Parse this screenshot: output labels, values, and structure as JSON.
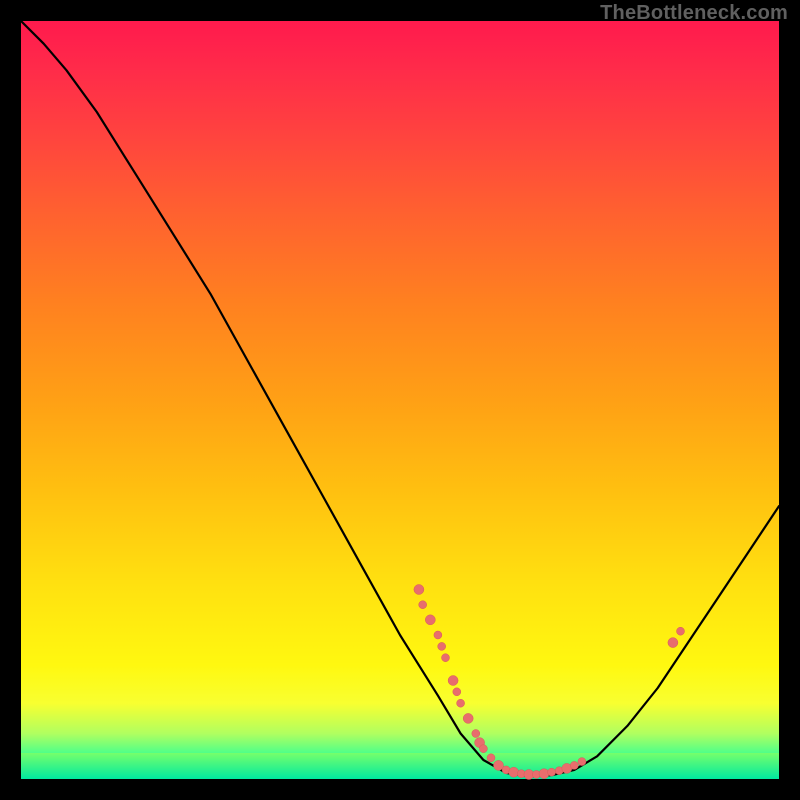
{
  "watermark": "TheBottleneck.com",
  "colors": {
    "curve_stroke": "#000000",
    "point_fill": "#e86d6d",
    "point_stroke": "#d85a5a"
  },
  "chart_data": {
    "type": "line",
    "title": "",
    "xlabel": "",
    "ylabel": "",
    "xlim": [
      0,
      100
    ],
    "ylim": [
      0,
      100
    ],
    "curve": [
      {
        "x": 0,
        "y": 100
      },
      {
        "x": 3,
        "y": 97
      },
      {
        "x": 6,
        "y": 93.5
      },
      {
        "x": 10,
        "y": 88
      },
      {
        "x": 15,
        "y": 80
      },
      {
        "x": 20,
        "y": 72
      },
      {
        "x": 25,
        "y": 64
      },
      {
        "x": 30,
        "y": 55
      },
      {
        "x": 35,
        "y": 46
      },
      {
        "x": 40,
        "y": 37
      },
      {
        "x": 45,
        "y": 28
      },
      {
        "x": 50,
        "y": 19
      },
      {
        "x": 55,
        "y": 11
      },
      {
        "x": 58,
        "y": 6
      },
      {
        "x": 61,
        "y": 2.5
      },
      {
        "x": 64,
        "y": 0.8
      },
      {
        "x": 67,
        "y": 0.3
      },
      {
        "x": 70,
        "y": 0.5
      },
      {
        "x": 73,
        "y": 1.2
      },
      {
        "x": 76,
        "y": 3
      },
      {
        "x": 80,
        "y": 7
      },
      {
        "x": 84,
        "y": 12
      },
      {
        "x": 88,
        "y": 18
      },
      {
        "x": 92,
        "y": 24
      },
      {
        "x": 96,
        "y": 30
      },
      {
        "x": 100,
        "y": 36
      }
    ],
    "points": [
      {
        "x": 52.5,
        "y": 25,
        "r": 5
      },
      {
        "x": 53,
        "y": 23,
        "r": 4
      },
      {
        "x": 54,
        "y": 21,
        "r": 5
      },
      {
        "x": 55,
        "y": 19,
        "r": 4
      },
      {
        "x": 55.5,
        "y": 17.5,
        "r": 4
      },
      {
        "x": 56,
        "y": 16,
        "r": 4
      },
      {
        "x": 57,
        "y": 13,
        "r": 5
      },
      {
        "x": 57.5,
        "y": 11.5,
        "r": 4
      },
      {
        "x": 58,
        "y": 10,
        "r": 4
      },
      {
        "x": 59,
        "y": 8,
        "r": 5
      },
      {
        "x": 60,
        "y": 6,
        "r": 4
      },
      {
        "x": 60.5,
        "y": 4.8,
        "r": 5
      },
      {
        "x": 61,
        "y": 4,
        "r": 4
      },
      {
        "x": 62,
        "y": 2.8,
        "r": 4
      },
      {
        "x": 63,
        "y": 1.8,
        "r": 5
      },
      {
        "x": 64,
        "y": 1.2,
        "r": 4
      },
      {
        "x": 65,
        "y": 0.9,
        "r": 5
      },
      {
        "x": 66,
        "y": 0.7,
        "r": 4
      },
      {
        "x": 67,
        "y": 0.6,
        "r": 5
      },
      {
        "x": 68,
        "y": 0.6,
        "r": 4
      },
      {
        "x": 69,
        "y": 0.7,
        "r": 5
      },
      {
        "x": 70,
        "y": 0.9,
        "r": 4
      },
      {
        "x": 71,
        "y": 1.1,
        "r": 4
      },
      {
        "x": 72,
        "y": 1.4,
        "r": 5
      },
      {
        "x": 73,
        "y": 1.8,
        "r": 4
      },
      {
        "x": 74,
        "y": 2.3,
        "r": 4
      },
      {
        "x": 86,
        "y": 18,
        "r": 5
      },
      {
        "x": 87,
        "y": 19.5,
        "r": 4
      }
    ]
  }
}
